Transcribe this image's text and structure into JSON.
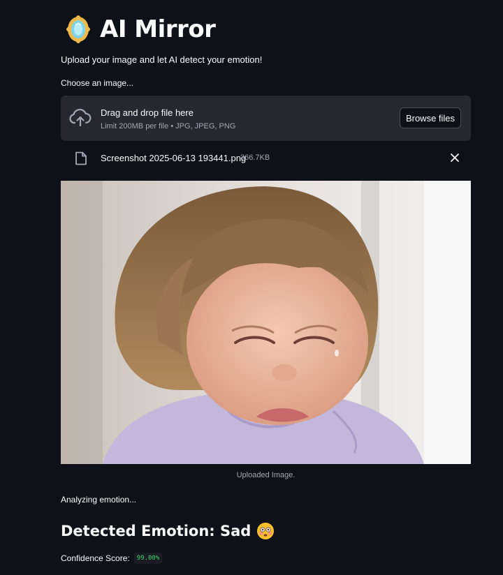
{
  "header": {
    "icon": "magic-mirror-icon",
    "title": "AI Mirror",
    "subtitle": "Upload your image and let AI detect your emotion!"
  },
  "uploader": {
    "label": "Choose an image...",
    "dropzone_text": "Drag and drop file here",
    "limit_text": "Limit 200MB per file • JPG, JPEG, PNG",
    "browse_label": "Browse files",
    "upload_icon": "cloud-upload-icon"
  },
  "uploaded_file": {
    "icon": "file-icon",
    "name": "Screenshot 2025-06-13 193441.png",
    "size": "366.7KB",
    "remove_icon": "close-icon"
  },
  "image": {
    "caption": "Uploaded Image."
  },
  "analysis": {
    "status": "Analyzing emotion...",
    "heading": "Detected Emotion: Sad",
    "emoji_icon": "flushed-face-emoji",
    "confidence_label": "Confidence Score:",
    "confidence_value": "99.00%"
  },
  "colors": {
    "background": "#0e1117",
    "panel": "#262730",
    "text": "#fafafa",
    "muted_text": "#a3a8b8",
    "code_green": "#3dd56d"
  }
}
